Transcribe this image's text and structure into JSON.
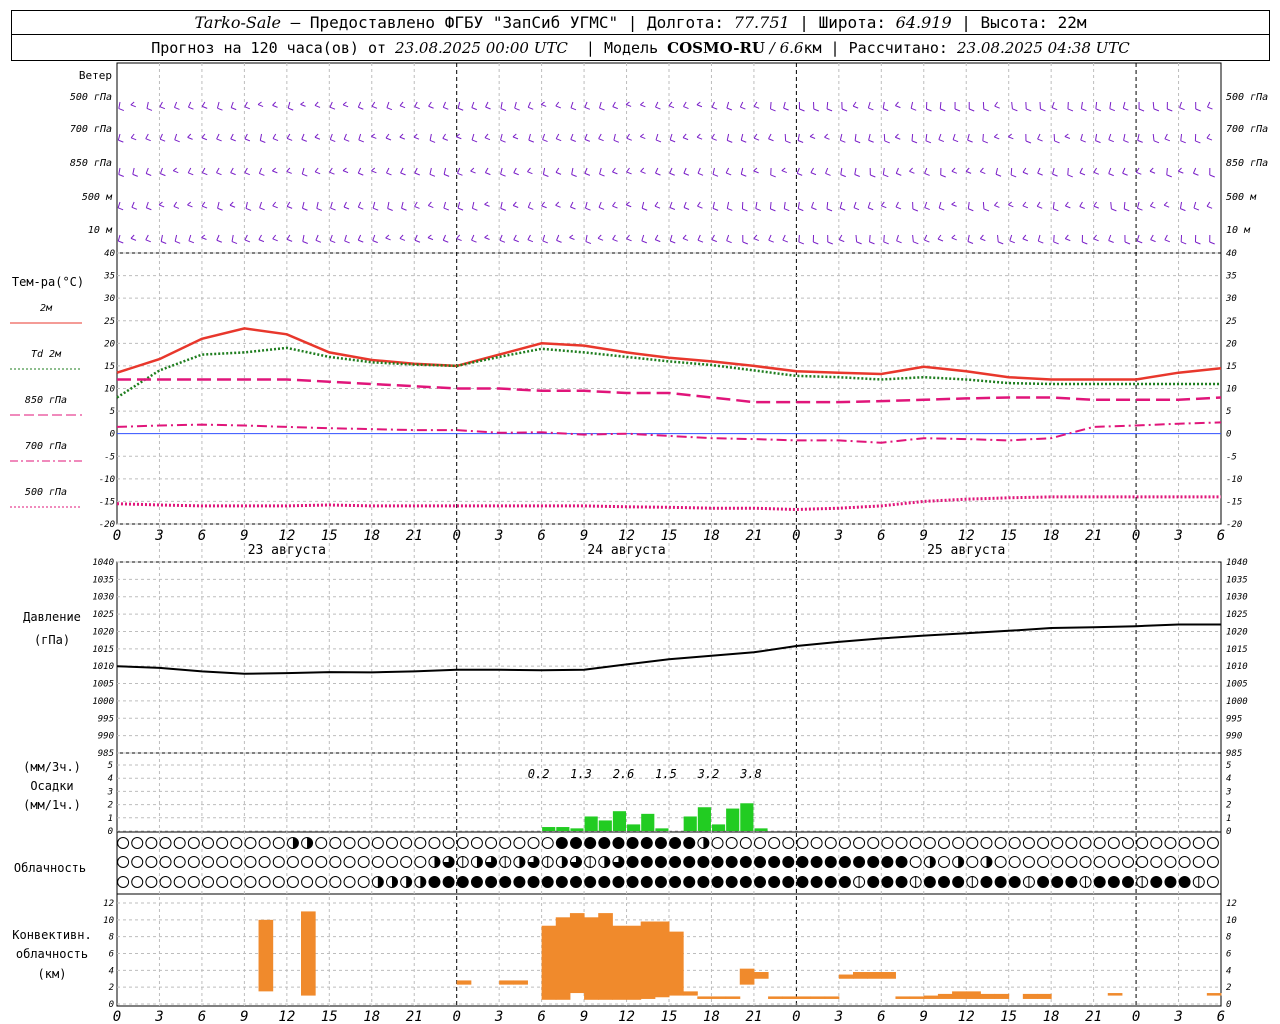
{
  "header": {
    "station": "Tarko-Sale",
    "provider": " – Предоставлено ФГБУ \"ЗапСиб УГМС\" | Долгота: ",
    "lon": "77.751",
    "lat_label": " | Широта: ",
    "lat": "64.919",
    "alt_label": " | Высота: ",
    "alt": "22м",
    "fc_label": "Прогноз на 120 часа(ов) от ",
    "fc_time": "23.08.2025 00:00 UTC",
    "model_label": "  | Модель ",
    "model": "COSMO-RU",
    "model_res": " / 6.6",
    "model_res_unit": "км",
    "calc_label": " | Рассчитано: ",
    "calc_time": "23.08.2025 04:38 UTC"
  },
  "wind": {
    "title": "Ветер",
    "levels": [
      "500 гПа",
      "700 гПа",
      "850 гПа",
      "500 м",
      "10  м"
    ],
    "color": "#7a1fc8"
  },
  "temperature": {
    "title": "Тем-ра(°C)",
    "legend": [
      {
        "label": "2м",
        "color": "#e8372c",
        "style": "solid"
      },
      {
        "label": "Td 2м",
        "color": "#1e7d1e",
        "style": "dot"
      },
      {
        "label": "850 гПа",
        "color": "#e0157a",
        "style": "dash"
      },
      {
        "label": "700 гПа",
        "color": "#e0157a",
        "style": "dashdot"
      },
      {
        "label": "500 гПа",
        "color": "#e0157a",
        "style": "dot"
      }
    ],
    "y_ticks": [
      "40",
      "35",
      "30",
      "25",
      "20",
      "15",
      "10",
      "5",
      "0",
      "-5",
      "-10",
      "-15",
      "-20"
    ]
  },
  "x_axis": {
    "hour_ticks": [
      "0",
      "3",
      "6",
      "9",
      "12",
      "15",
      "18",
      "21",
      "0",
      "3",
      "6",
      "9",
      "12",
      "15",
      "18",
      "21",
      "0",
      "3",
      "6",
      "9",
      "12",
      "15",
      "18",
      "21",
      "0",
      "3",
      "6"
    ],
    "days": [
      "23 августа",
      "24 августа",
      "25 августа"
    ]
  },
  "pressure": {
    "title": "Давление",
    "unit": "(гПа)",
    "y_ticks": [
      "1040",
      "1035",
      "1030",
      "1025",
      "1020",
      "1015",
      "1010",
      "1005",
      "1000",
      "995",
      "990",
      "985"
    ]
  },
  "precip": {
    "unit_top": "(мм/3ч.)",
    "title": "Осадки",
    "unit_bottom": "(мм/1ч.)",
    "y_ticks": [
      "5",
      "4",
      "3",
      "2",
      "1",
      "0"
    ],
    "totals_3h": [
      "0.2",
      "1.3",
      "2.6",
      "1.5",
      "3.2",
      "3.8"
    ],
    "color": "#22cc22"
  },
  "cloud": {
    "title": "Облачность"
  },
  "convective": {
    "title1": "Конвективн.",
    "title2": "облачность",
    "unit": "(км)",
    "y_ticks": [
      "12",
      "10",
      "8",
      "6",
      "4",
      "2",
      "0"
    ],
    "color": "#f08a2c"
  },
  "chart_data": [
    {
      "type": "line",
      "title": "Тем-ра(°C)",
      "ylim": [
        -20,
        40
      ],
      "x_hours": [
        0,
        3,
        6,
        9,
        12,
        15,
        18,
        21,
        24,
        27,
        30,
        33,
        36,
        39,
        42,
        45,
        48,
        51,
        54,
        57,
        60,
        63,
        66,
        69,
        72,
        75,
        78
      ],
      "series": [
        {
          "name": "2м",
          "values": [
            13.5,
            16.5,
            21,
            23.3,
            22,
            18,
            16.3,
            15.5,
            15,
            17.5,
            20,
            19.5,
            18,
            16.8,
            16,
            15,
            13.8,
            13.5,
            13.2,
            14.8,
            13.8,
            12.5,
            12,
            12,
            12,
            13.5,
            14.5
          ]
        },
        {
          "name": "Td 2м",
          "values": [
            8,
            14,
            17.5,
            18,
            19,
            17,
            15.8,
            15.3,
            15,
            17,
            18.8,
            18,
            17,
            16,
            15.2,
            14,
            12.8,
            12.5,
            12,
            12.5,
            12,
            11.2,
            11,
            11,
            11,
            11,
            11
          ]
        },
        {
          "name": "850 гПа",
          "values": [
            12,
            12,
            12,
            12,
            12,
            11.5,
            11,
            10.5,
            10,
            10,
            9.5,
            9.5,
            9,
            9,
            8,
            7,
            7,
            7,
            7.2,
            7.5,
            7.8,
            8,
            8,
            7.5,
            7.5,
            7.5,
            8
          ]
        },
        {
          "name": "700 гПа",
          "values": [
            1.5,
            1.8,
            2,
            1.8,
            1.5,
            1.2,
            1,
            0.8,
            0.8,
            0.2,
            0.3,
            -0.2,
            0,
            -0.5,
            -1,
            -1.2,
            -1.5,
            -1.5,
            -2,
            -1,
            -1.2,
            -1.5,
            -1,
            1.5,
            1.8,
            2.2,
            2.5
          ]
        },
        {
          "name": "500 гПа",
          "values": [
            -15.5,
            -15.8,
            -16,
            -16,
            -16,
            -15.8,
            -16,
            -16,
            -16,
            -16,
            -16,
            -16,
            -16.2,
            -16.3,
            -16.5,
            -16.5,
            -16.8,
            -16.5,
            -16,
            -15,
            -14.5,
            -14.2,
            -14,
            -14,
            -14,
            -14,
            -14
          ]
        }
      ]
    },
    {
      "type": "line",
      "title": "Давление",
      "ylim": [
        985,
        1040
      ],
      "x_hours": [
        0,
        3,
        6,
        9,
        12,
        15,
        18,
        21,
        24,
        27,
        30,
        33,
        36,
        39,
        42,
        45,
        48,
        51,
        54,
        57,
        60,
        63,
        66,
        69,
        72,
        75,
        78
      ],
      "series": [
        {
          "name": "",
          "values": [
            1010,
            1009.5,
            1008.5,
            1007.8,
            1008,
            1008.3,
            1008.2,
            1008.5,
            1009,
            1009,
            1008.8,
            1009,
            1010.5,
            1012,
            1013,
            1014,
            1015.8,
            1017,
            1018,
            1018.8,
            1019.5,
            1020.2,
            1021,
            1021.2,
            1021.5,
            1022,
            1022
          ]
        }
      ]
    },
    {
      "type": "bar",
      "title": "Осадки (мм/1ч.)",
      "ylim": [
        0,
        5
      ],
      "x_hours": [
        30,
        31,
        32,
        33,
        34,
        35,
        36,
        37,
        38,
        39,
        40,
        41,
        42,
        43,
        44,
        45,
        46,
        47
      ],
      "values": [
        0.3,
        0.3,
        0.2,
        1.1,
        0.8,
        1.5,
        0.5,
        1.3,
        0.2,
        0,
        1.1,
        1.8,
        0.5,
        1.7,
        2.1,
        0.2,
        0,
        0
      ]
    },
    {
      "type": "bar",
      "title": "Конвективн. облачность (км)",
      "ylim": [
        0,
        12
      ],
      "bars": [
        {
          "h": 10,
          "base": 1.5,
          "top": 10
        },
        {
          "h": 13,
          "base": 1,
          "top": 11
        },
        {
          "h": 24,
          "base": 2.3,
          "top": 2.8
        },
        {
          "h": 27,
          "base": 2.3,
          "top": 2.8
        },
        {
          "h": 28,
          "base": 2.3,
          "top": 2.8
        },
        {
          "h": 30,
          "base": 0.5,
          "top": 9.3
        },
        {
          "h": 31,
          "base": 0.5,
          "top": 10.3
        },
        {
          "h": 32,
          "base": 1.3,
          "top": 10.8
        },
        {
          "h": 33,
          "base": 0.5,
          "top": 10.3
        },
        {
          "h": 34,
          "base": 0.5,
          "top": 10.8
        },
        {
          "h": 35,
          "base": 0.5,
          "top": 9.3
        },
        {
          "h": 36,
          "base": 0.5,
          "top": 9.3
        },
        {
          "h": 37,
          "base": 0.6,
          "top": 9.8
        },
        {
          "h": 38,
          "base": 0.8,
          "top": 9.8
        },
        {
          "h": 39,
          "base": 1.0,
          "top": 8.6
        },
        {
          "h": 40,
          "base": 1.0,
          "top": 1.5
        },
        {
          "h": 41,
          "base": 0.6,
          "top": 0.9
        },
        {
          "h": 42,
          "base": 0.6,
          "top": 0.9
        },
        {
          "h": 43,
          "base": 0.6,
          "top": 0.9
        },
        {
          "h": 44,
          "base": 2.3,
          "top": 4.2
        },
        {
          "h": 45,
          "base": 3.0,
          "top": 3.8
        },
        {
          "h": 46,
          "base": 0.6,
          "top": 0.9
        },
        {
          "h": 47,
          "base": 0.6,
          "top": 0.9
        },
        {
          "h": 48,
          "base": 0.6,
          "top": 0.9
        },
        {
          "h": 49,
          "base": 0.6,
          "top": 0.9
        },
        {
          "h": 50,
          "base": 0.6,
          "top": 0.9
        },
        {
          "h": 51,
          "base": 3.0,
          "top": 3.5
        },
        {
          "h": 52,
          "base": 3.0,
          "top": 3.8
        },
        {
          "h": 53,
          "base": 3.0,
          "top": 3.8
        },
        {
          "h": 54,
          "base": 3.0,
          "top": 3.8
        },
        {
          "h": 55,
          "base": 0.6,
          "top": 0.9
        },
        {
          "h": 56,
          "base": 0.6,
          "top": 0.9
        },
        {
          "h": 57,
          "base": 0.6,
          "top": 1.0
        },
        {
          "h": 58,
          "base": 0.6,
          "top": 1.2
        },
        {
          "h": 59,
          "base": 0.6,
          "top": 1.5
        },
        {
          "h": 60,
          "base": 0.6,
          "top": 1.5
        },
        {
          "h": 61,
          "base": 0.6,
          "top": 1.2
        },
        {
          "h": 62,
          "base": 0.6,
          "top": 1.2
        },
        {
          "h": 64,
          "base": 0.6,
          "top": 1.2
        },
        {
          "h": 65,
          "base": 0.6,
          "top": 1.2
        },
        {
          "h": 70,
          "base": 1.0,
          "top": 1.3
        },
        {
          "h": 77,
          "base": 1.0,
          "top": 1.3
        }
      ]
    }
  ]
}
